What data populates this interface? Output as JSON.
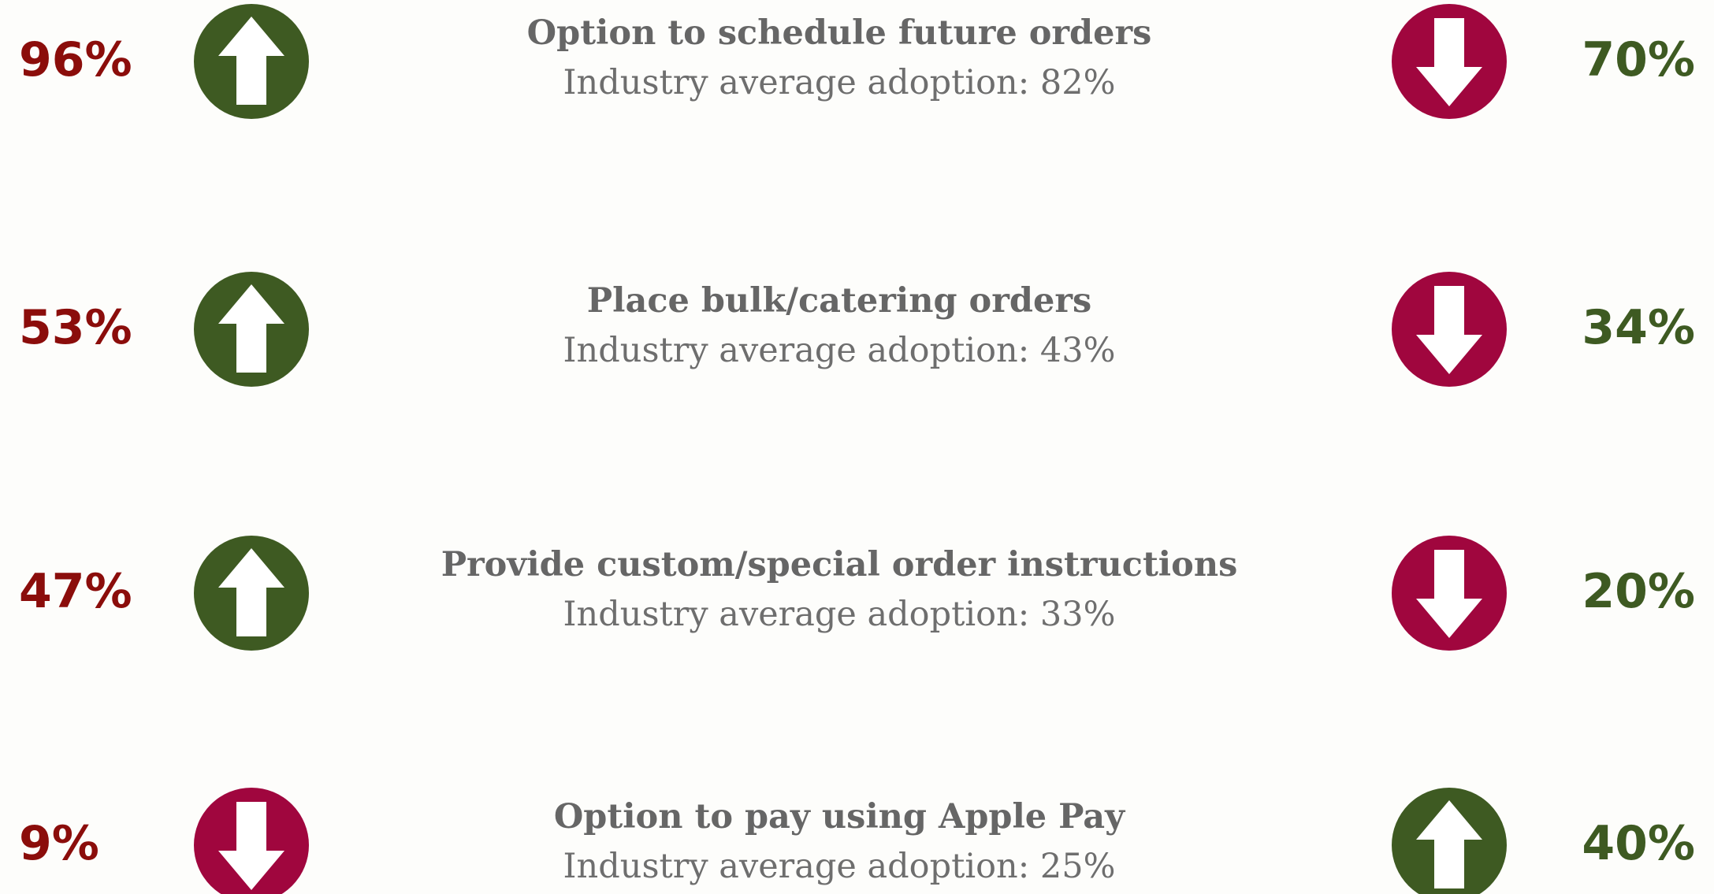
{
  "colors": {
    "green": "#3e5a22",
    "crimson": "#a0063e",
    "dark_red": "#8b0d0b",
    "text_gray": "#666666",
    "arrow_white": "#ffffff"
  },
  "rows": [
    {
      "left_value": "96%",
      "left_color": "#8b0d0b",
      "left_icon": "arrow-up-icon",
      "title": "Option to schedule future orders",
      "subtitle": "Industry average adoption: 82%",
      "right_icon": "arrow-down-icon",
      "right_value": "70%",
      "right_color": "#3e5a22"
    },
    {
      "left_value": "53%",
      "left_color": "#8b0d0b",
      "left_icon": "arrow-up-icon",
      "title": "Place bulk/catering orders",
      "subtitle": "Industry average adoption: 43%",
      "right_icon": "arrow-down-icon",
      "right_value": "34%",
      "right_color": "#3e5a22"
    },
    {
      "left_value": "47%",
      "left_color": "#8b0d0b",
      "left_icon": "arrow-up-icon",
      "title": "Provide custom/special order instructions",
      "subtitle": "Industry average adoption: 33%",
      "right_icon": "arrow-down-icon",
      "right_value": "20%",
      "right_color": "#3e5a22"
    },
    {
      "left_value": "9%",
      "left_color": "#8b0d0b",
      "left_icon": "arrow-down-icon",
      "title": "Option to pay using Apple Pay",
      "subtitle": "Industry average adoption: 25%",
      "right_icon": "arrow-up-icon",
      "right_value": "40%",
      "right_color": "#3e5a22"
    }
  ]
}
